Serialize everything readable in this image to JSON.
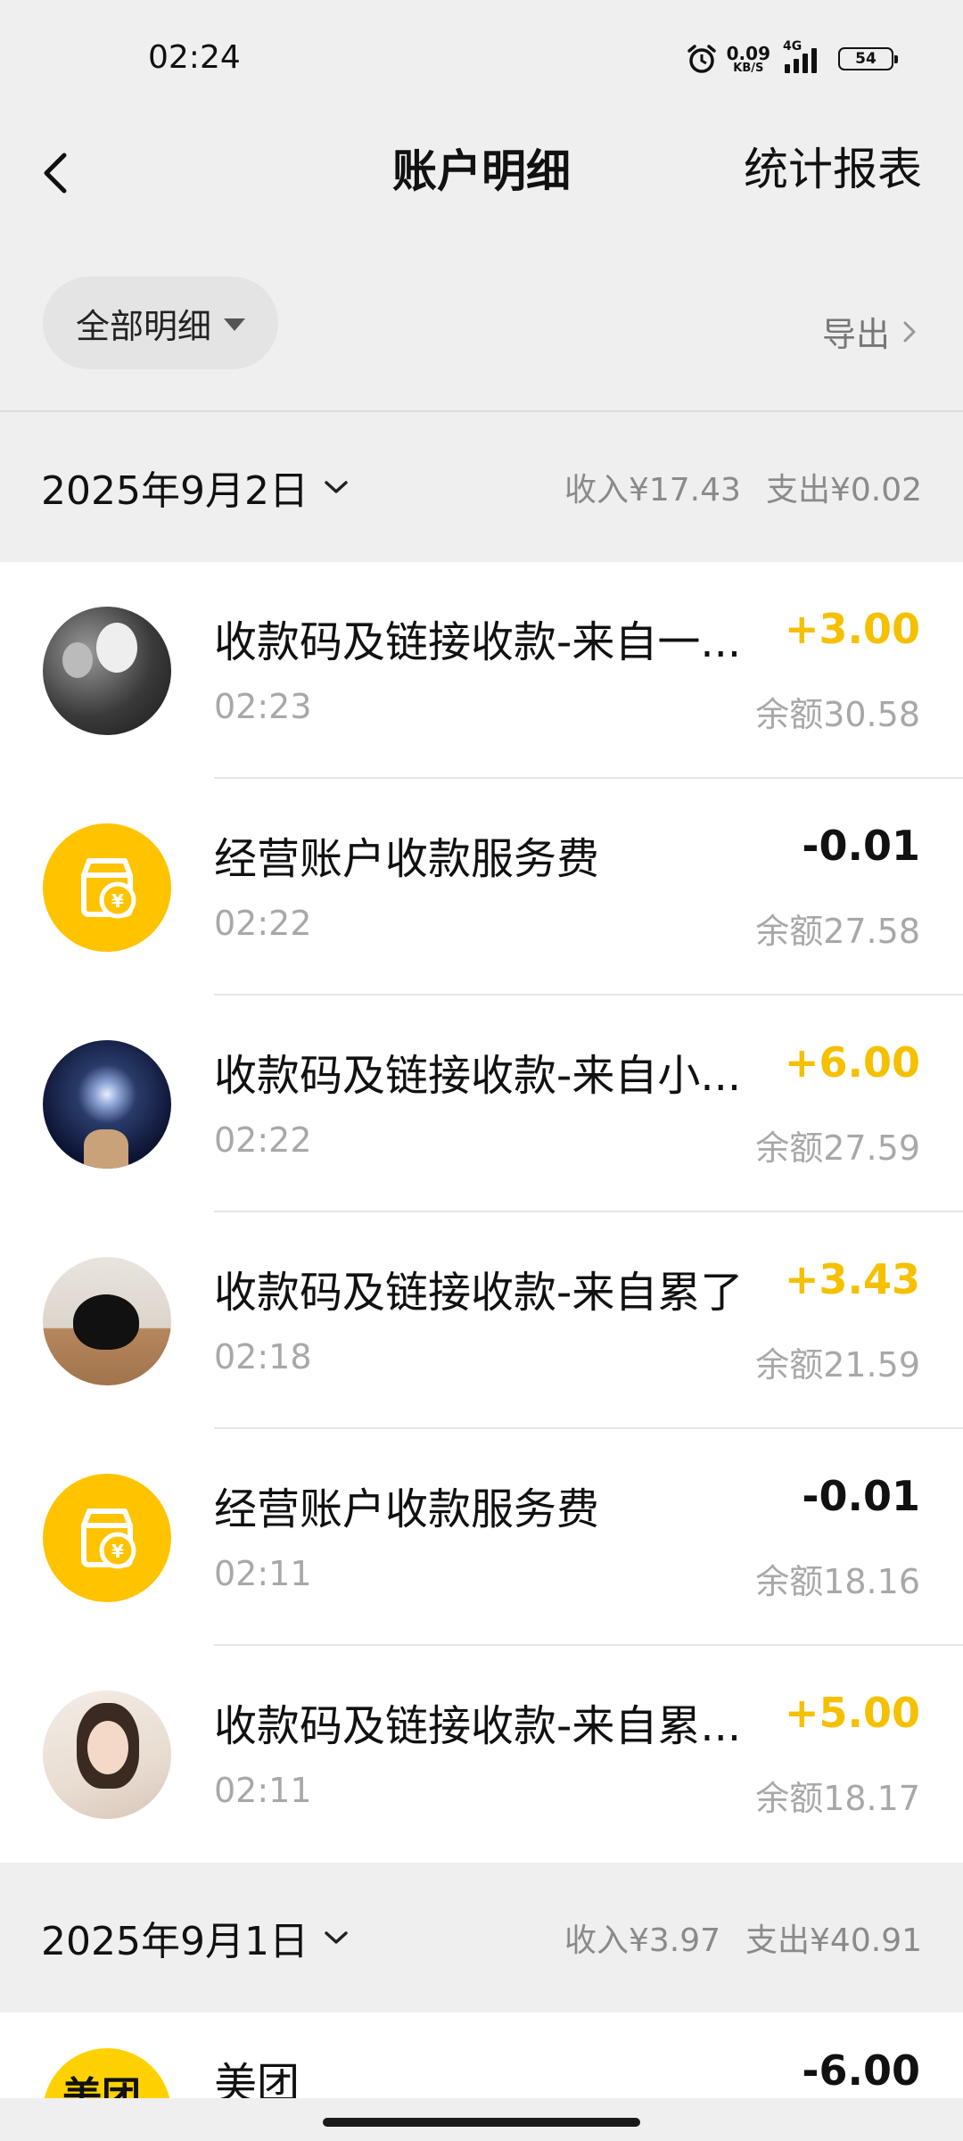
{
  "status_bar": {
    "time": "02:24",
    "net_speed_value": "0.09",
    "net_speed_unit": "KB/S",
    "network_type": "4G",
    "battery_level": "54"
  },
  "header": {
    "title": "账户明细",
    "right_link": "统计报表"
  },
  "filter": {
    "selected": "全部明细",
    "export_label": "导出"
  },
  "sections": [
    {
      "date": "2025年9月2日",
      "income": "收入¥17.43",
      "expense": "支出¥0.02",
      "items": [
        {
          "title": "收款码及链接收款-来自一...",
          "time": "02:23",
          "amount": "+3.00",
          "type": "income",
          "balance": "余额30.58",
          "avatar": "photo-group"
        },
        {
          "title": "经营账户收款服务费",
          "time": "02:22",
          "amount": "-0.01",
          "type": "expense",
          "balance": "余额27.58",
          "avatar": "shop-icon"
        },
        {
          "title": "收款码及链接收款-来自小...",
          "time": "02:22",
          "amount": "+6.00",
          "type": "income",
          "balance": "余额27.59",
          "avatar": "photo-moon"
        },
        {
          "title": "收款码及链接收款-来自累了",
          "time": "02:18",
          "amount": "+3.43",
          "type": "income",
          "balance": "余额21.59",
          "avatar": "photo-cat"
        },
        {
          "title": "经营账户收款服务费",
          "time": "02:11",
          "amount": "-0.01",
          "type": "expense",
          "balance": "余额18.16",
          "avatar": "shop-icon"
        },
        {
          "title": "收款码及链接收款-来自累...",
          "time": "02:11",
          "amount": "+5.00",
          "type": "income",
          "balance": "余额18.17",
          "avatar": "photo-girl"
        }
      ]
    },
    {
      "date": "2025年9月1日",
      "income": "收入¥3.97",
      "expense": "支出¥40.91",
      "items": [
        {
          "title": "美团",
          "time": "",
          "amount": "-6.00",
          "type": "expense",
          "balance": "",
          "avatar": "meituan-logo",
          "logo_text": "美团"
        }
      ]
    }
  ],
  "colors": {
    "income": "#f5c000",
    "expense": "#111111",
    "shop_icon_bg": "#ffc300",
    "page_bg": "#efefef"
  }
}
